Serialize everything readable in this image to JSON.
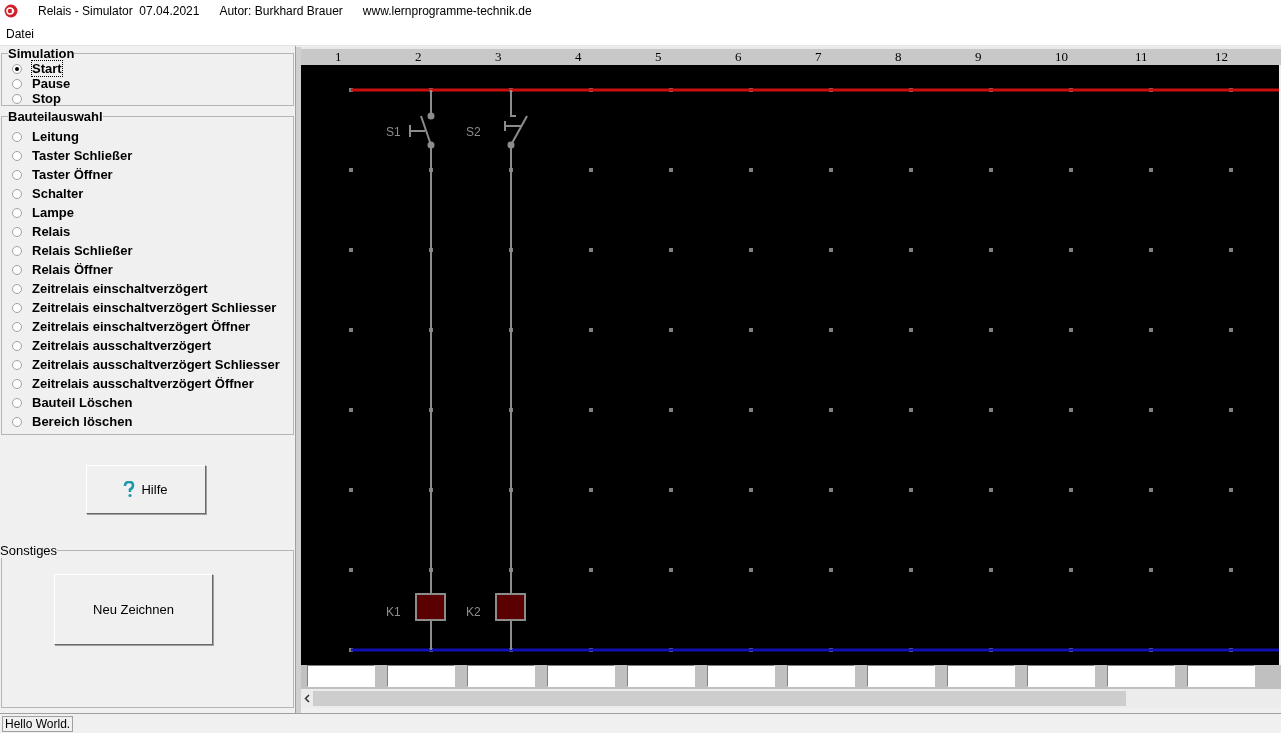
{
  "window": {
    "title_parts": [
      "Relais - Simulator  07.04.2021",
      "Autor: Burkhard Brauer",
      "www.lernprogramme-technik.de"
    ]
  },
  "menu": [
    "Datei"
  ],
  "simulation": {
    "title": "Simulation",
    "options": [
      {
        "label": "Start",
        "selected": true
      },
      {
        "label": "Pause",
        "selected": false
      },
      {
        "label": "Stop",
        "selected": false
      }
    ]
  },
  "parts": {
    "title": "Bauteilauswahl",
    "options": [
      {
        "label": "Leitung",
        "selected": false
      },
      {
        "label": "Taster Schließer",
        "selected": false
      },
      {
        "label": "Taster Öffner",
        "selected": false
      },
      {
        "label": "Schalter",
        "selected": false
      },
      {
        "label": "Lampe",
        "selected": false
      },
      {
        "label": "Relais",
        "selected": false
      },
      {
        "label": "Relais Schließer",
        "selected": false
      },
      {
        "label": "Relais Öffner",
        "selected": false
      },
      {
        "label": "Zeitrelais einschaltverzögert",
        "selected": false
      },
      {
        "label": "Zeitrelais einschaltverzögert Schliesser",
        "selected": false
      },
      {
        "label": "Zeitrelais einschaltverzögert Öffner",
        "selected": false
      },
      {
        "label": "Zeitrelais ausschaltverzögert",
        "selected": false
      },
      {
        "label": "Zeitrelais ausschaltverzögert Schliesser",
        "selected": false
      },
      {
        "label": "Zeitrelais ausschaltverzögert Öffner",
        "selected": false
      },
      {
        "label": "Bauteil Löschen",
        "selected": false
      },
      {
        "label": "Bereich löschen",
        "selected": false
      }
    ]
  },
  "help_button": "Hilfe",
  "misc": {
    "title": "Sonstiges",
    "button": "Neu Zeichnen"
  },
  "canvas": {
    "columns": [
      "1",
      "2",
      "3",
      "4",
      "5",
      "6",
      "7",
      "8",
      "9",
      "10",
      "11",
      "12"
    ],
    "branches": [
      {
        "switch": {
          "kind": "normally_open",
          "label": "S1"
        },
        "coil": {
          "label": "K1"
        }
      },
      {
        "switch": {
          "kind": "normally_closed",
          "label": "S2"
        },
        "coil": {
          "label": "K2"
        }
      }
    ]
  },
  "status_bar": "Hello World."
}
